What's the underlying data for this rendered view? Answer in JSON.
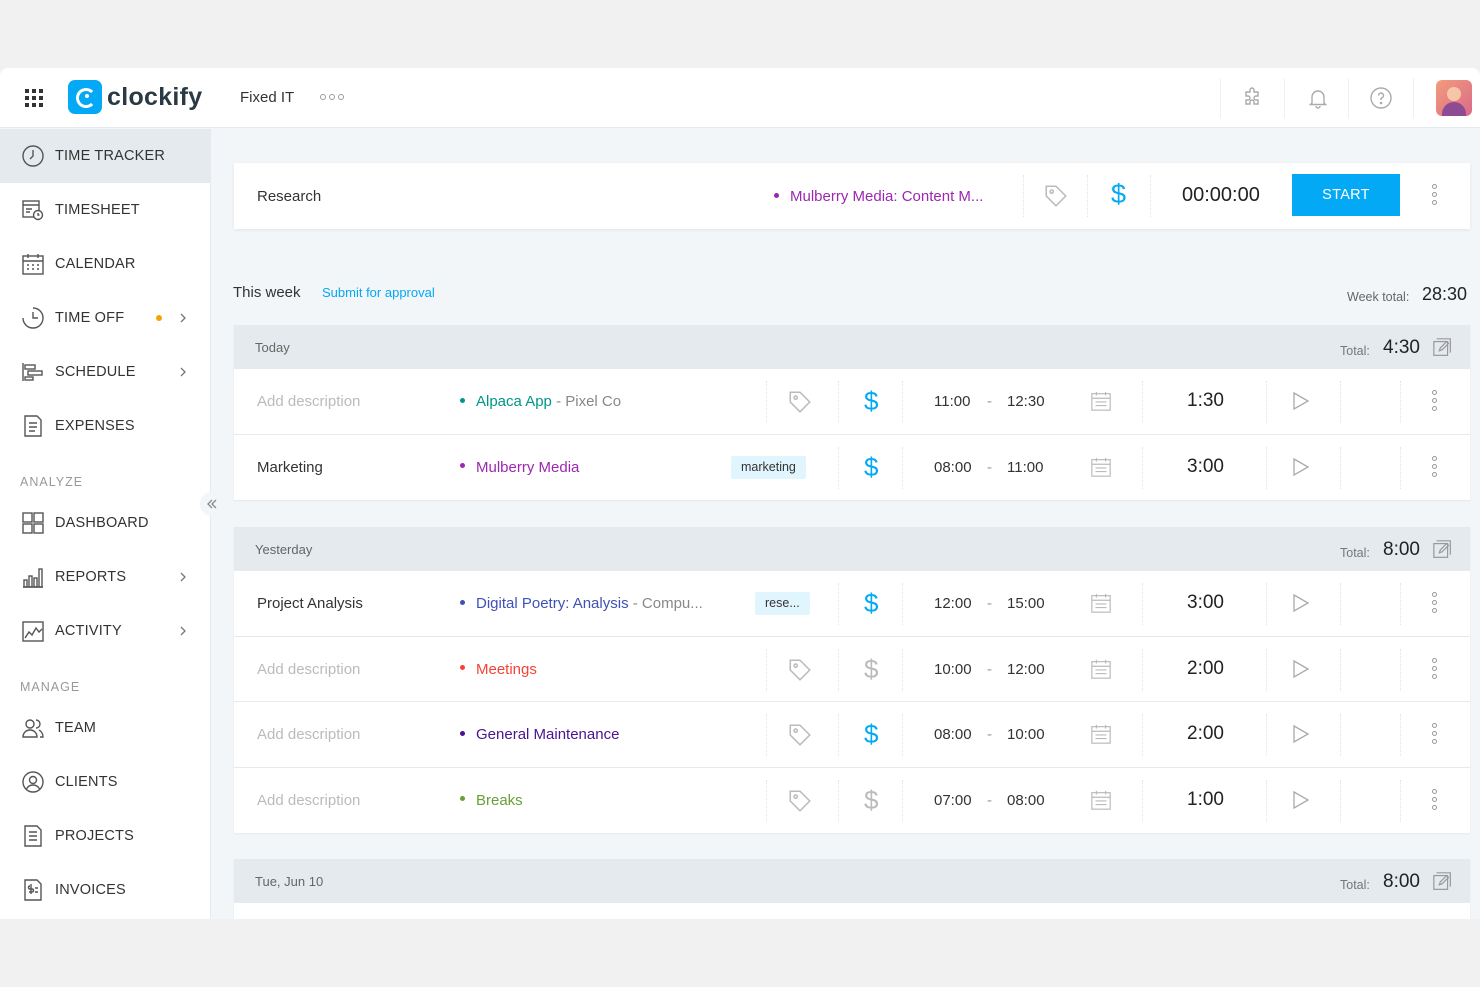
{
  "header": {
    "logo_text": "clockify",
    "workspace": "Fixed IT"
  },
  "sidebar": {
    "items": [
      {
        "label": "TIME TRACKER"
      },
      {
        "label": "TIMESHEET"
      },
      {
        "label": "CALENDAR"
      },
      {
        "label": "TIME OFF"
      },
      {
        "label": "SCHEDULE"
      },
      {
        "label": "EXPENSES"
      },
      {
        "label": "DASHBOARD"
      },
      {
        "label": "REPORTS"
      },
      {
        "label": "ACTIVITY"
      },
      {
        "label": "TEAM"
      },
      {
        "label": "CLIENTS"
      },
      {
        "label": "PROJECTS"
      },
      {
        "label": "INVOICES"
      }
    ],
    "sections": {
      "analyze": "ANALYZE",
      "manage": "MANAGE"
    }
  },
  "tracker": {
    "description": "Research",
    "project": "Mulberry Media: Content M...",
    "timer": "00:00:00",
    "start_label": "START",
    "project_color": "#9c27b0"
  },
  "week": {
    "title": "This week",
    "submit_label": "Submit for approval",
    "total_label": "Week total:",
    "total": "28:30"
  },
  "groups": [
    {
      "day": "Today",
      "total_label": "Total:",
      "total": "4:30",
      "entries": [
        {
          "description": "Add description",
          "project": "Alpaca App",
          "client": "Pixel Co",
          "color": "#009688",
          "start": "11:00",
          "end": "12:30",
          "duration": "1:30"
        },
        {
          "description": "Marketing",
          "project": "Mulberry Media",
          "client": "",
          "color": "#9c27b0",
          "tag": "marketing",
          "start": "08:00",
          "end": "11:00",
          "duration": "3:00"
        }
      ]
    },
    {
      "day": "Yesterday",
      "total_label": "Total:",
      "total": "8:00",
      "entries": [
        {
          "description": "Project Analysis",
          "project": "Digital Poetry: Analysis",
          "client": "Compu...",
          "color": "#3f51b5",
          "tag": "rese...",
          "start": "12:00",
          "end": "15:00",
          "duration": "3:00"
        },
        {
          "description": "Add description",
          "project": "Meetings",
          "client": "",
          "color": "#f44336",
          "start": "10:00",
          "end": "12:00",
          "duration": "2:00"
        },
        {
          "description": "Add description",
          "project": "General Maintenance",
          "client": "",
          "color": "#4a148c",
          "start": "08:00",
          "end": "10:00",
          "duration": "2:00"
        },
        {
          "description": "Add description",
          "project": "Breaks",
          "client": "",
          "color": "#689f38",
          "start": "07:00",
          "end": "08:00",
          "duration": "1:00"
        }
      ]
    },
    {
      "day": "Tue, Jun 10",
      "total_label": "Total:",
      "total": "8:00",
      "entries": []
    }
  ],
  "colors": {
    "accent": "#03a9f4",
    "billable": "#03a9f4",
    "non_billable": "#999999"
  }
}
